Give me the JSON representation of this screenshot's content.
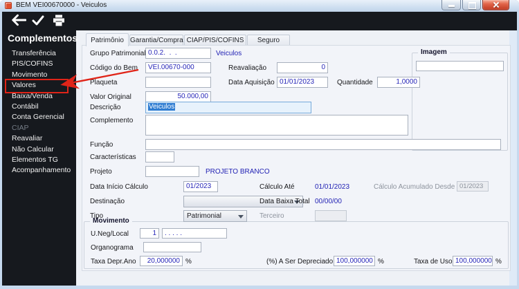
{
  "window": {
    "title": "BEM VEI00670000 - Veiculos"
  },
  "sidebar": {
    "title": "Complementos",
    "items": [
      {
        "label": "Transferência"
      },
      {
        "label": "PIS/COFINS"
      },
      {
        "label": "Movimento"
      },
      {
        "label": "Valores",
        "highlighted": true
      },
      {
        "label": "Baixa/Venda"
      },
      {
        "label": "Contábil"
      },
      {
        "label": "Conta Gerencial"
      },
      {
        "label": "CIAP",
        "disabled": true
      },
      {
        "label": "Reavaliar"
      },
      {
        "label": "Não Calcular"
      },
      {
        "label": "Elementos TG"
      },
      {
        "label": "Acompanhamento"
      }
    ]
  },
  "tabs": {
    "items": [
      {
        "label": "Patrimônio",
        "active": true
      },
      {
        "label": "Garantia/Compra"
      },
      {
        "label": "CIAP/PIS/COFINS"
      },
      {
        "label": "Seguro"
      }
    ]
  },
  "form": {
    "grupo_patrimonial": {
      "label": "Grupo Patrimonial",
      "value": "0.0.2.  .  .",
      "description": "Veiculos"
    },
    "codigo_bem": {
      "label": "Código do Bem",
      "value": "VEI.00670-000"
    },
    "reavaliacao": {
      "label": "Reavaliação",
      "value": "0"
    },
    "plaqueta": {
      "label": "Plaqueta",
      "value": ""
    },
    "data_aquisicao": {
      "label": "Data Aquisição",
      "value": "01/01/2023"
    },
    "quantidade": {
      "label": "Quantidade",
      "value": "1,0000"
    },
    "valor_original": {
      "label": "Valor Original",
      "value": "50.000,00"
    },
    "descricao": {
      "label": "Descrição",
      "value": "Veiculos"
    },
    "complemento": {
      "label": "Complemento",
      "value": ""
    },
    "funcao": {
      "label": "Função",
      "value": ""
    },
    "caracteristicas": {
      "label": "Características",
      "value": ""
    },
    "projeto": {
      "label": "Projeto",
      "value": "",
      "description": "PROJETO BRANCO"
    },
    "data_inicio_calculo": {
      "label": "Data Início Cálculo",
      "value": "01/2023"
    },
    "calculo_ate": {
      "label": "Cálculo Até",
      "value": "01/01/2023"
    },
    "calculo_acumulado_desde": {
      "label": "Cálculo Acumulado Desde",
      "value": "01/2023"
    },
    "destinacao": {
      "label": "Destinação",
      "value": ""
    },
    "data_baixa_total": {
      "label": "Data Baixa Total",
      "value": "00/00/00"
    },
    "tipo": {
      "label": "Tipo",
      "value": "Patrimonial"
    },
    "terceiro": {
      "label": "Terceiro",
      "value": ""
    },
    "imagem": {
      "label": "Imagem",
      "value": ""
    },
    "movimento": {
      "title": "Movimento",
      "uneg_local": {
        "label": "U.Neg/Local",
        "value1": "1",
        "value2": ". . . . ."
      },
      "organograma": {
        "label": "Organograma",
        "value": ""
      },
      "taxa_depr_ano": {
        "label": "Taxa Depr.Ano",
        "value": "20,000000",
        "unit": "%"
      },
      "a_ser_depreciado": {
        "label": "(%) A Ser Depreciado",
        "value": "100,000000",
        "unit": "%"
      },
      "taxa_uso": {
        "label": "Taxa de Uso",
        "value": "100,000000",
        "unit": "%"
      }
    }
  },
  "annotation": {
    "color": "#e02418"
  }
}
